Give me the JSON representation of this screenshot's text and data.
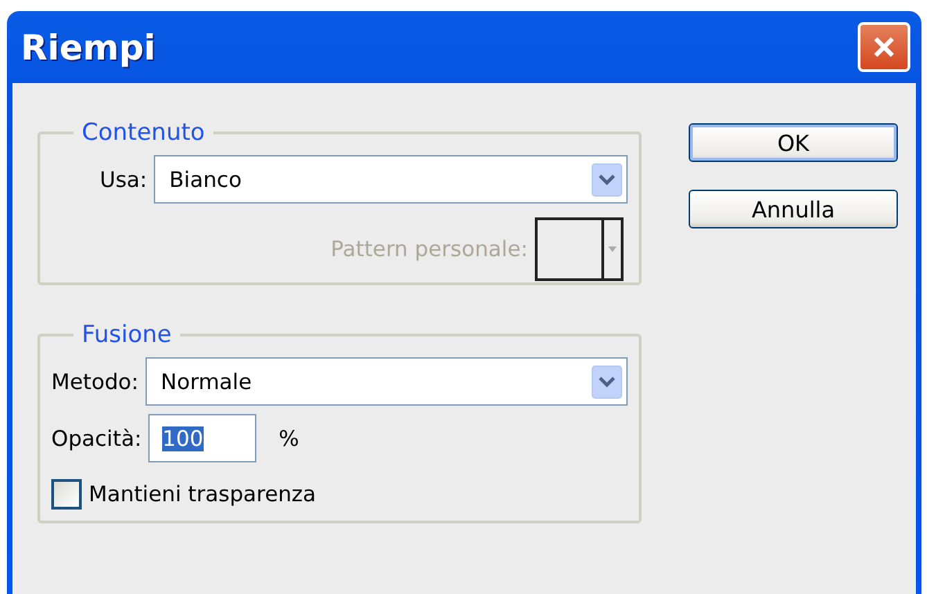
{
  "window": {
    "title": "Riempi"
  },
  "groups": [
    {
      "title": "Contenuto",
      "fields": [
        {
          "kind": "dropdown",
          "label": "Usa:",
          "value": "Bianco"
        },
        {
          "kind": "swatch",
          "label": "Pattern personale:",
          "disabled": true
        }
      ]
    },
    {
      "title": "Fusione",
      "fields": [
        {
          "kind": "dropdown",
          "label": "Metodo:",
          "value": "Normale"
        },
        {
          "kind": "number",
          "label": "Opacità:",
          "value": "100",
          "unit": "%",
          "selected": true
        },
        {
          "kind": "checkbox",
          "label": "Mantieni trasparenza",
          "checked": false
        }
      ]
    }
  ],
  "buttons": [
    {
      "label": "OK",
      "default": true
    },
    {
      "label": "Annulla",
      "default": false
    }
  ]
}
